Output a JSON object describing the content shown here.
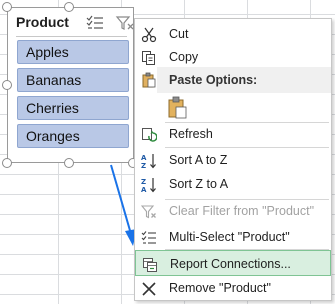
{
  "slicer": {
    "title": "Product",
    "items": [
      "Apples",
      "Bananas",
      "Cherries",
      "Oranges"
    ],
    "multiselect_icon": "multi-select-icon",
    "clearfilter_icon": "clear-filter-icon"
  },
  "menu": {
    "cut": "Cut",
    "copy": "Copy",
    "paste_options": "Paste Options:",
    "refresh": "Refresh",
    "sort_az": "Sort A to Z",
    "sort_za": "Sort Z to A",
    "clear_filter": "Clear Filter from \"Product\"",
    "multi_select": "Multi-Select \"Product\"",
    "report_connections": "Report Connections...",
    "remove": "Remove \"Product\""
  },
  "colors": {
    "slicer_item_bg": "#b9c8e6",
    "highlight_bg": "#d9efe0",
    "highlight_border": "#7fc494",
    "arrow": "#1a73e8"
  }
}
